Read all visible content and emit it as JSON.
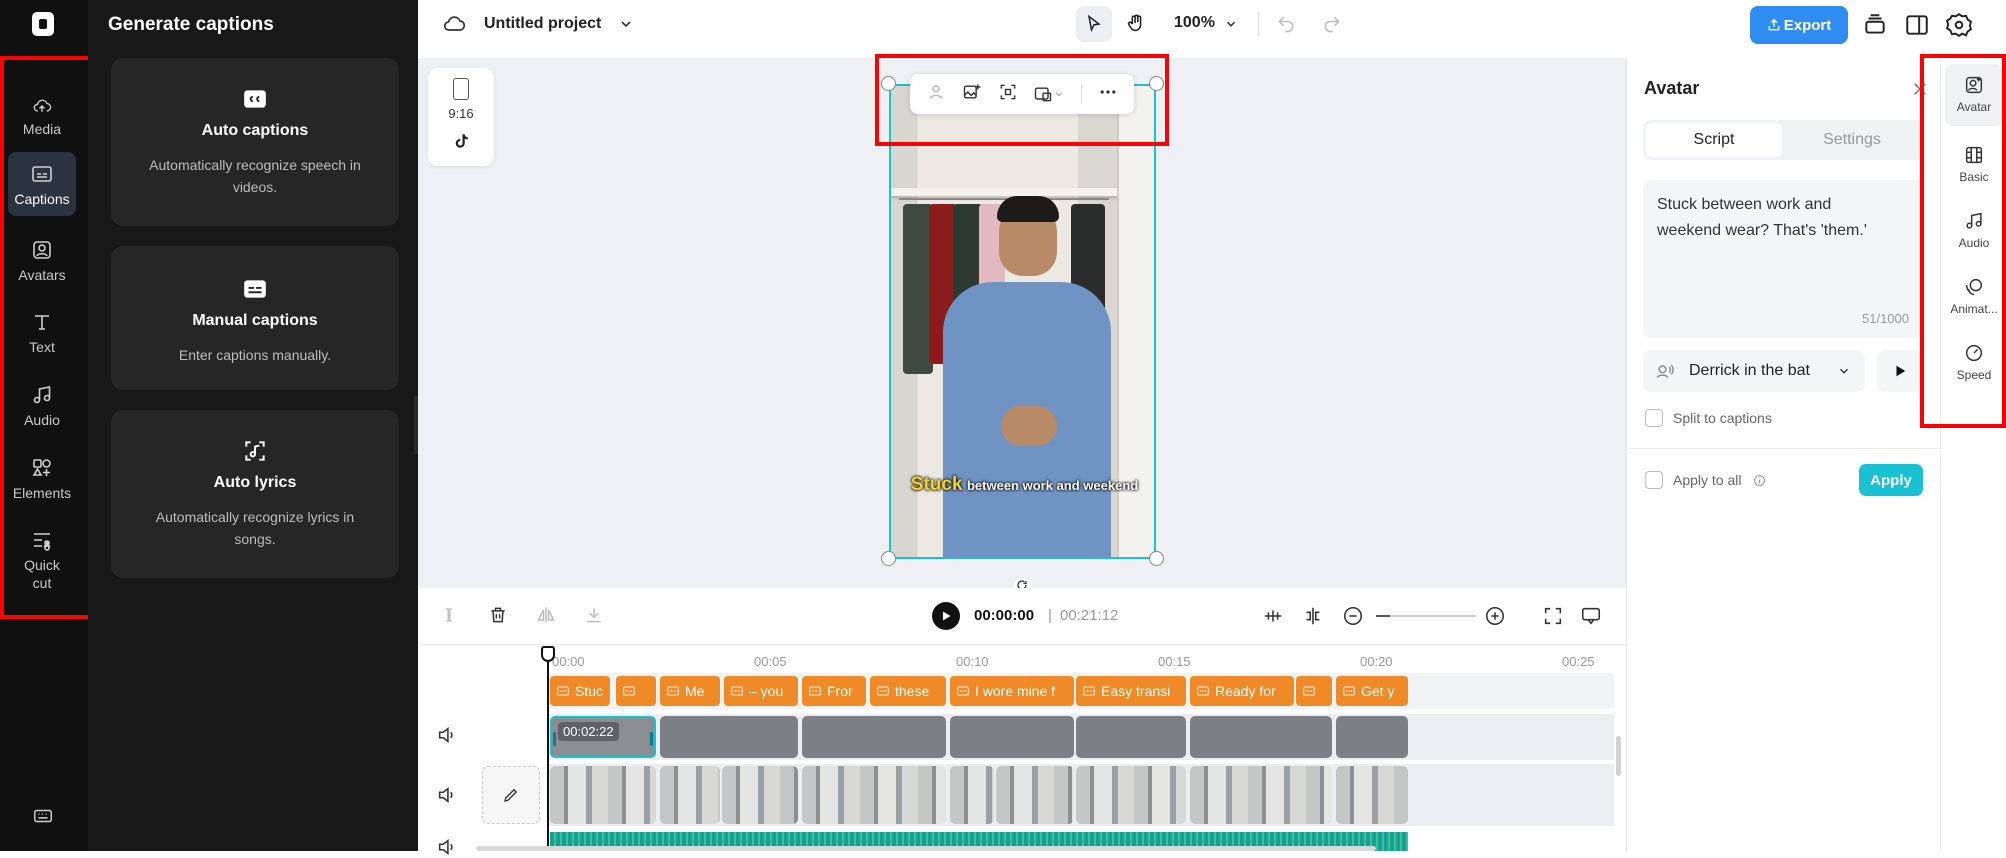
{
  "rail": {
    "items": [
      {
        "label": "Media",
        "icon": "cloud-upload-icon"
      },
      {
        "label": "Captions",
        "icon": "captions-icon"
      },
      {
        "label": "Avatars",
        "icon": "avatar-icon"
      },
      {
        "label": "Text",
        "icon": "text-icon"
      },
      {
        "label": "Audio",
        "icon": "music-note-icon"
      },
      {
        "label": "Elements",
        "icon": "elements-icon"
      },
      {
        "label": "Quick cut",
        "icon": "quick-cut-icon"
      }
    ],
    "active": "Captions"
  },
  "panel": {
    "title": "Generate captions",
    "cards": [
      {
        "title": "Auto captions",
        "desc": "Automatically recognize speech in videos.",
        "icon": "cc-icon"
      },
      {
        "title": "Manual captions",
        "desc": "Enter captions manually.",
        "icon": "keyboard-captions-icon"
      },
      {
        "title": "Auto lyrics",
        "desc": "Automatically recognize lyrics in songs.",
        "icon": "lyrics-icon"
      }
    ]
  },
  "topbar": {
    "project_name": "Untitled project",
    "zoom": "100%",
    "export_label": "Export"
  },
  "ratio": {
    "label": "9:16"
  },
  "video": {
    "caption_highlight": "Stuck",
    "caption_rest": "between work and weekend"
  },
  "timeline": {
    "current_time": "00:00:00",
    "total_time": "00:21:12",
    "ruler": [
      "00:00",
      "00:05",
      "00:10",
      "00:15",
      "00:20",
      "00:25"
    ],
    "clip_duration": "00:02:22",
    "caption_clips": [
      "Stuc",
      "",
      "Me",
      "– you",
      "Fror",
      "these",
      "I wore mine f",
      "Easy transi",
      "Ready for",
      "",
      "Get y"
    ]
  },
  "avatar_panel": {
    "title": "Avatar",
    "tabs": [
      "Script",
      "Settings"
    ],
    "active_tab": "Script",
    "script_text": "Stuck between work and weekend wear? That's 'them.'",
    "char_count": "51/1000",
    "voice": "Derrick in the bat",
    "split_label": "Split to captions",
    "apply_all_label": "Apply to all",
    "apply_label": "Apply"
  },
  "tabrail": {
    "items": [
      {
        "label": "Avatar",
        "icon": "avatar-icon"
      },
      {
        "label": "Basic",
        "icon": "film-icon"
      },
      {
        "label": "Audio",
        "icon": "music-note-icon"
      },
      {
        "label": "Animat...",
        "icon": "animation-icon"
      },
      {
        "label": "Speed",
        "icon": "speed-icon"
      }
    ],
    "active": "Avatar"
  },
  "colors": {
    "accent": "#19c2d3",
    "caption_clip": "#f08a26",
    "export": "#2f8cf0",
    "highlight_box": "#ff0000"
  }
}
